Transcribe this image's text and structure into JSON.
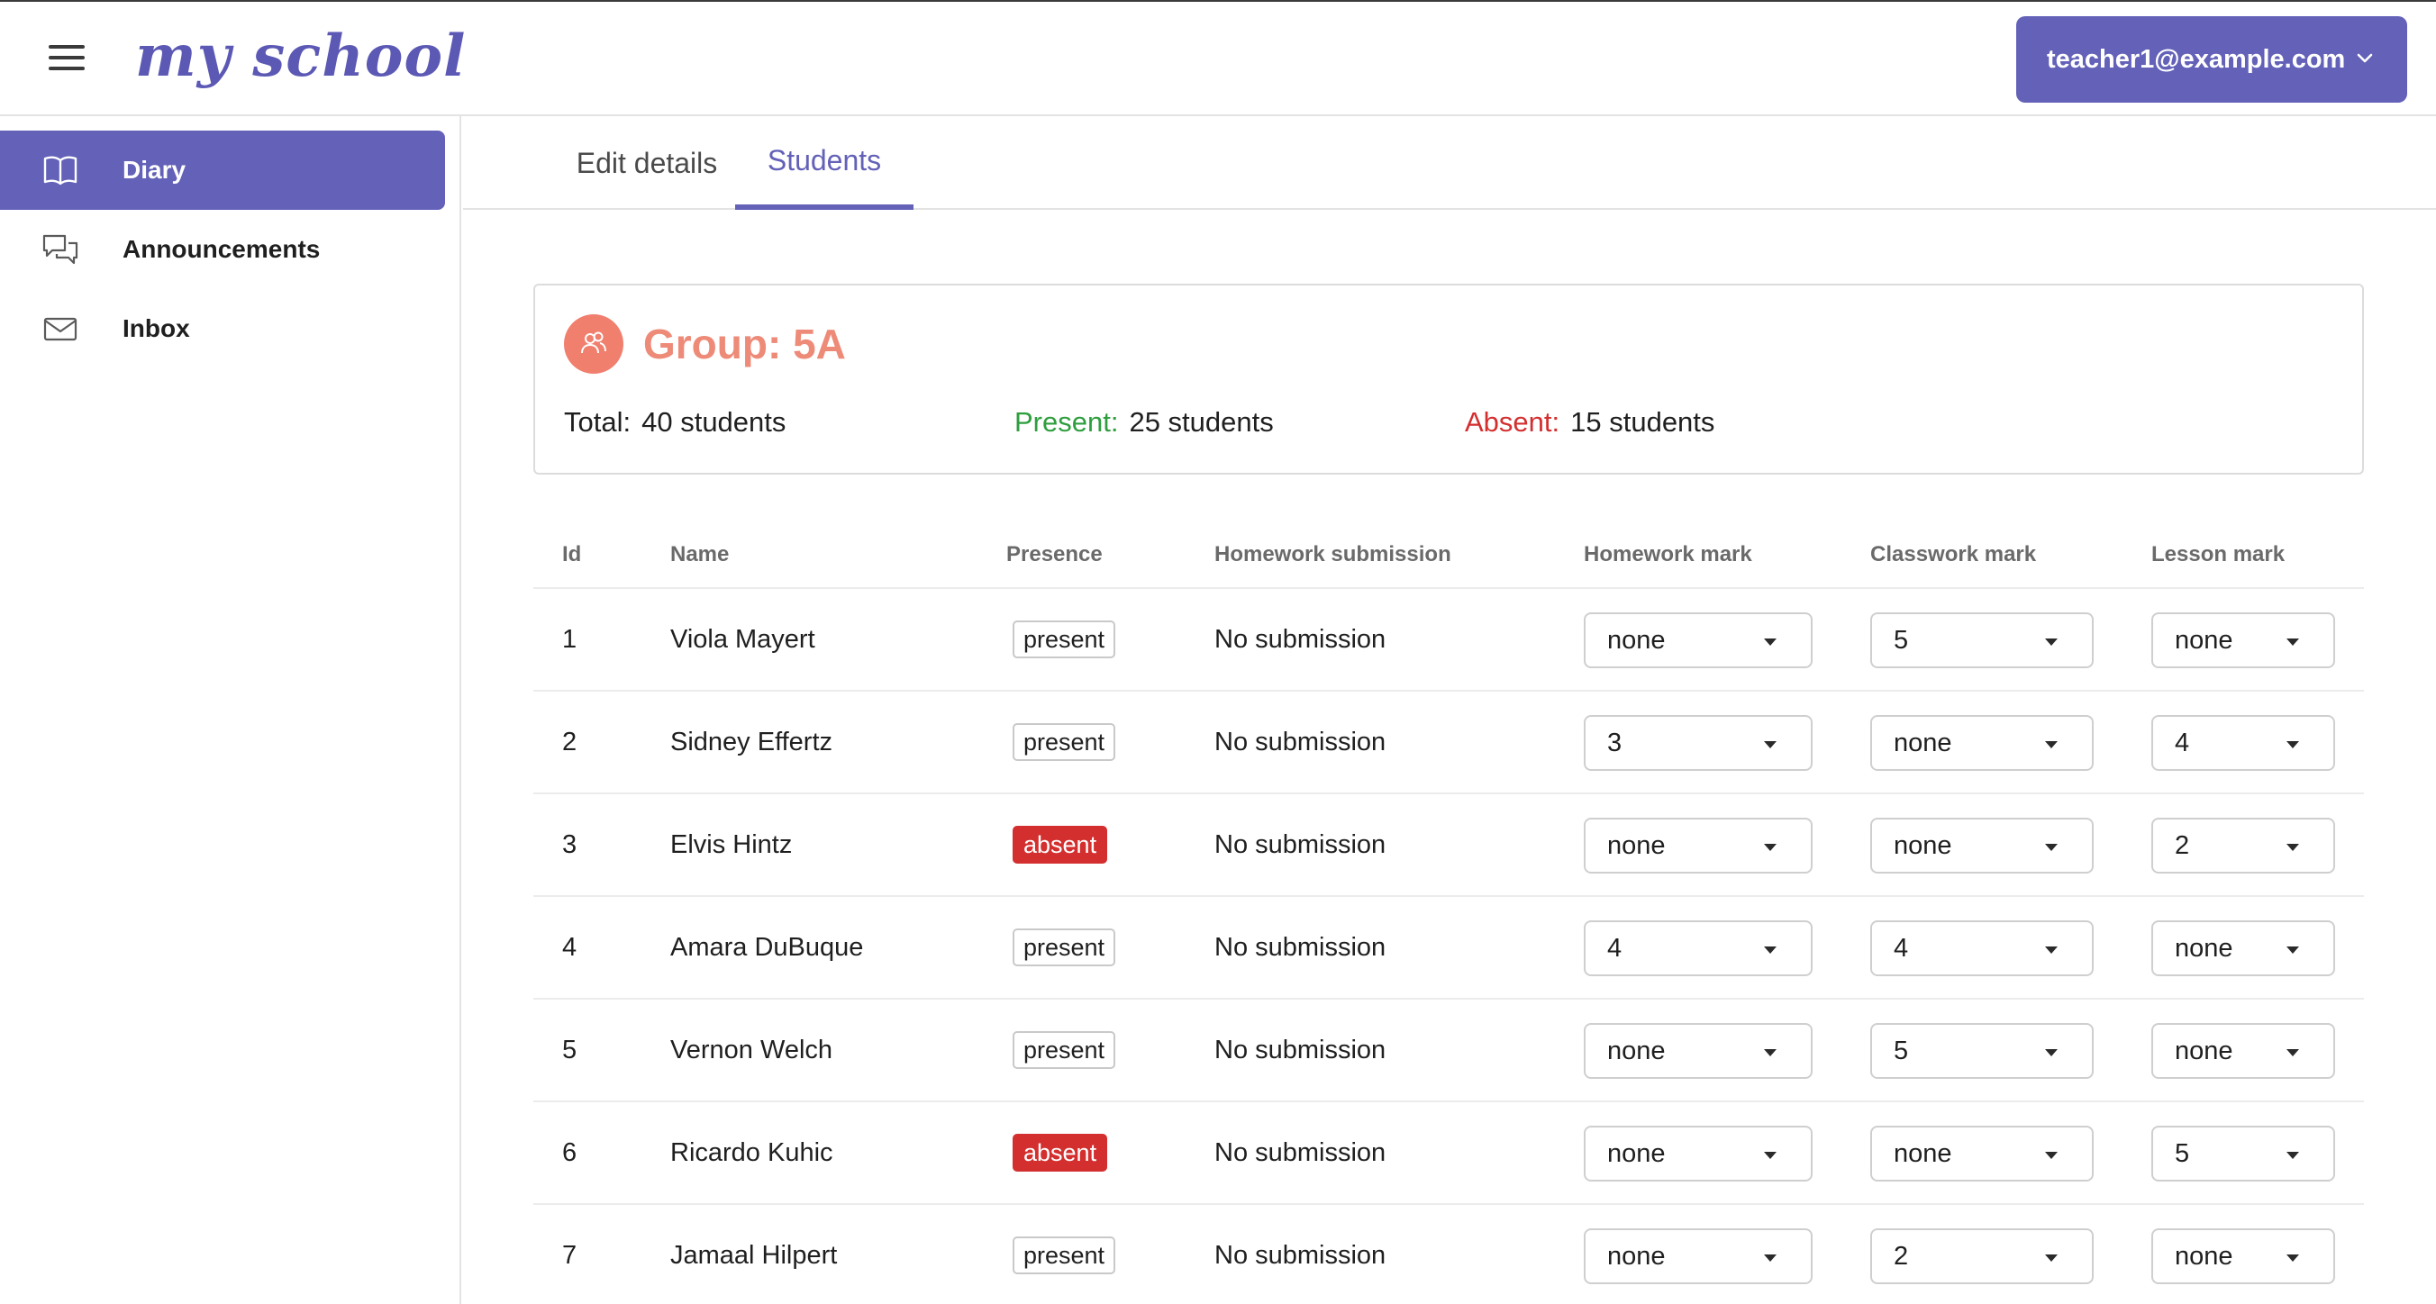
{
  "app": {
    "logo": "my school",
    "user_email": "teacher1@example.com"
  },
  "sidebar": {
    "items": [
      {
        "label": "Diary",
        "icon": "book-open-icon",
        "active": true
      },
      {
        "label": "Announcements",
        "icon": "chat-bubbles-icon",
        "active": false
      },
      {
        "label": "Inbox",
        "icon": "envelope-icon",
        "active": false
      }
    ]
  },
  "tabs": [
    {
      "label": "Edit details",
      "active": false
    },
    {
      "label": "Students",
      "active": true
    }
  ],
  "group": {
    "title": "Group: 5A",
    "total_label": "Total:",
    "total_value": "40 students",
    "present_label": "Present:",
    "present_value": "25 students",
    "absent_label": "Absent:",
    "absent_value": "15 students"
  },
  "table": {
    "headers": [
      "Id",
      "Name",
      "Presence",
      "Homework submission",
      "Homework mark",
      "Classwork mark",
      "Lesson mark"
    ],
    "rows": [
      {
        "id": "1",
        "name": "Viola Mayert",
        "presence": "present",
        "homework": "No submission",
        "hw_mark": "none",
        "cw_mark": "5",
        "lesson_mark": "none"
      },
      {
        "id": "2",
        "name": "Sidney Effertz",
        "presence": "present",
        "homework": "No submission",
        "hw_mark": "3",
        "cw_mark": "none",
        "lesson_mark": "4"
      },
      {
        "id": "3",
        "name": "Elvis Hintz",
        "presence": "absent",
        "homework": "No submission",
        "hw_mark": "none",
        "cw_mark": "none",
        "lesson_mark": "2"
      },
      {
        "id": "4",
        "name": "Amara DuBuque",
        "presence": "present",
        "homework": "No submission",
        "hw_mark": "4",
        "cw_mark": "4",
        "lesson_mark": "none"
      },
      {
        "id": "5",
        "name": "Vernon Welch",
        "presence": "present",
        "homework": "No submission",
        "hw_mark": "none",
        "cw_mark": "5",
        "lesson_mark": "none"
      },
      {
        "id": "6",
        "name": "Ricardo Kuhic",
        "presence": "absent",
        "homework": "No submission",
        "hw_mark": "none",
        "cw_mark": "none",
        "lesson_mark": "5"
      },
      {
        "id": "7",
        "name": "Jamaal Hilpert",
        "presence": "present",
        "homework": "No submission",
        "hw_mark": "none",
        "cw_mark": "2",
        "lesson_mark": "none"
      }
    ]
  },
  "colors": {
    "accent": "#6361b8",
    "group_title": "#ee8a78",
    "present_green": "#2e9e3e",
    "absent_red": "#d32f2f"
  }
}
